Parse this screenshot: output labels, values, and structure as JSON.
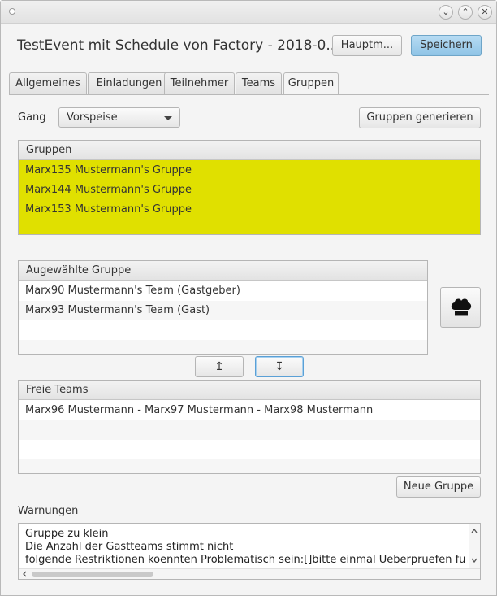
{
  "window": {
    "title_bar": {
      "minimize_glyph": "⌄",
      "maximize_glyph": "⌃",
      "close_glyph": "✕"
    }
  },
  "header": {
    "title": "TestEvent mit Schedule von Factory - 2018-0...",
    "hauptmenu_label": "Hauptm...",
    "save_label": "Speichern"
  },
  "tabs": [
    {
      "label": "Allgemeines",
      "active": false
    },
    {
      "label": "Einladungen",
      "active": false
    },
    {
      "label": "Teilnehmer",
      "active": false
    },
    {
      "label": "Teams",
      "active": false
    },
    {
      "label": "Gruppen",
      "active": true
    }
  ],
  "gang": {
    "label": "Gang",
    "selected": "Vorspeise",
    "generate_label": "Gruppen generieren"
  },
  "gruppen": {
    "header": "Gruppen",
    "items": [
      "Marx135 Mustermann's Gruppe",
      "Marx144 Mustermann's Gruppe",
      "Marx153 Mustermann's Gruppe"
    ],
    "highlight_color": "#e0e000"
  },
  "ausgewaehlte_gruppe": {
    "header": "Augewählte Gruppe",
    "items": [
      "Marx90 Mustermann's Team (Gastgeber)",
      "Marx93 Mustermann's Team (Gast)"
    ]
  },
  "move_buttons": {
    "up_glyph": "↥",
    "down_glyph": "↧"
  },
  "freie_teams": {
    "header": "Freie Teams",
    "items": [
      "Marx96 Mustermann - Marx97 Mustermann - Marx98 Mustermann"
    ]
  },
  "neue_gruppe_label": "Neue Gruppe",
  "warnungen": {
    "label": "Warnungen",
    "lines": [
      "Gruppe zu klein",
      "Die Anzahl der Gastteams stimmt nicht",
      "folgende Restriktionen koennten Problematisch sein:[]bitte einmal Ueberpruefen fu"
    ]
  },
  "colors": {
    "accent": "#8fc4e6",
    "selection": "#e0e000"
  },
  "icons": {
    "chef": "chef-hat-icon",
    "window": "window-menu-icon"
  }
}
